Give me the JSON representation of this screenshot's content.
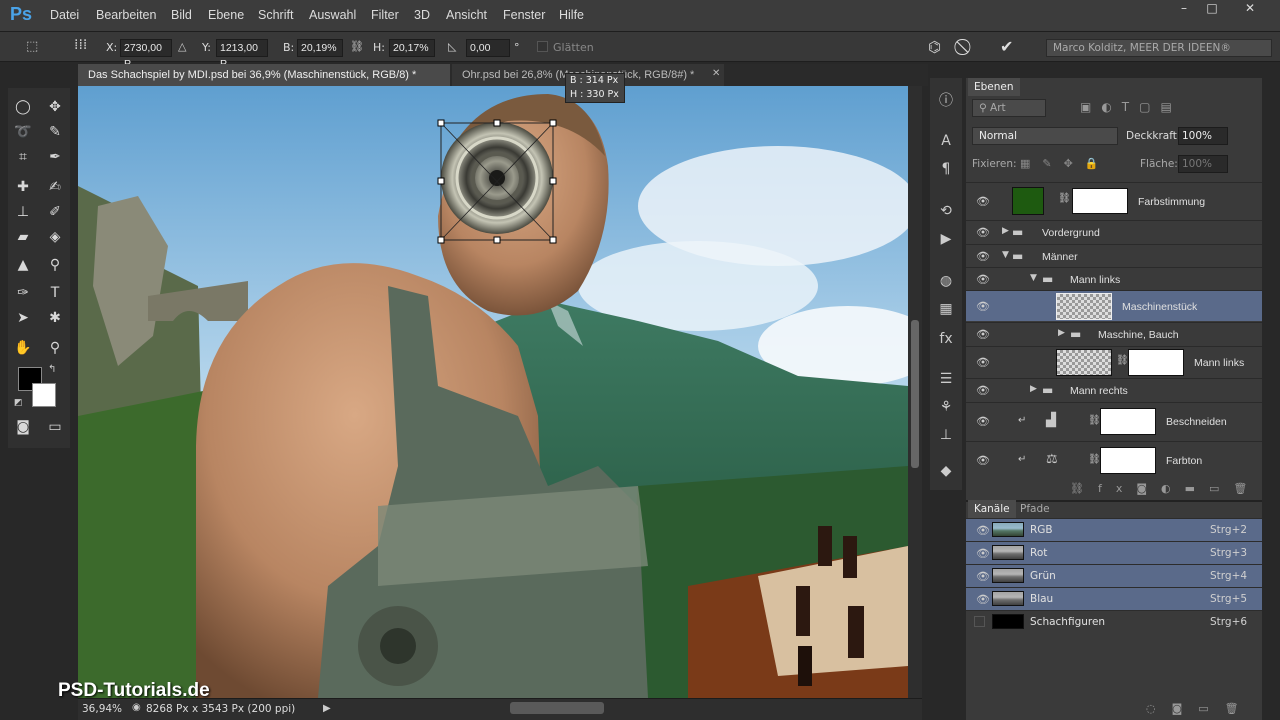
{
  "app": {
    "logo": "Ps"
  },
  "menu": [
    "Datei",
    "Bearbeiten",
    "Bild",
    "Ebene",
    "Schrift",
    "Auswahl",
    "Filter",
    "3D",
    "Ansicht",
    "Fenster",
    "Hilfe"
  ],
  "options": {
    "x_label": "X:",
    "x": "2730,00 P.",
    "y_label": "Y:",
    "y": "1213,00 P.",
    "w_label": "B:",
    "w": "20,19%",
    "h_label": "H:",
    "h": "20,17%",
    "angle": "0,00",
    "deg": "°",
    "smooth": "Glätten",
    "workspace": "Marco Kolditz, MEER DER IDEEN®"
  },
  "tabs": [
    {
      "label": "Das Schachspiel by MDI.psd bei 36,9% (Maschinenstück, RGB/8) *",
      "active": true
    },
    {
      "label": "Ohr.psd bei 26,8% (Maschinenstück, RGB/8#) *",
      "active": false
    }
  ],
  "transform_tip": {
    "w": "B : 314 Px",
    "h": "H : 330 Px"
  },
  "status": {
    "zoom": "36,94%",
    "doc": "8268 Px x 3543 Px (200 ppi)"
  },
  "watermark": "PSD-Tutorials.de",
  "layers_panel": {
    "tab": "Ebenen",
    "filter": "Art",
    "blend": "Normal",
    "opacity_label": "Deckkraft:",
    "opacity": "100%",
    "lock_label": "Fixieren:",
    "fill_label": "Fläche:",
    "fill": "100%",
    "layers": [
      {
        "name": "Farbstimmung"
      },
      {
        "name": "Vordergrund"
      },
      {
        "name": "Männer"
      },
      {
        "name": "Mann links"
      },
      {
        "name": "Maschinenstück",
        "selected": true
      },
      {
        "name": "Maschine, Bauch"
      },
      {
        "name": "Mann links"
      },
      {
        "name": "Mann rechts"
      },
      {
        "name": "Beschneiden"
      },
      {
        "name": "Farbton"
      }
    ]
  },
  "channels_panel": {
    "tabs": [
      "Kanäle",
      "Pfade"
    ],
    "channels": [
      {
        "name": "RGB",
        "key": "Strg+2"
      },
      {
        "name": "Rot",
        "key": "Strg+3"
      },
      {
        "name": "Grün",
        "key": "Strg+4"
      },
      {
        "name": "Blau",
        "key": "Strg+5"
      },
      {
        "name": "Schachfiguren",
        "key": "Strg+6"
      }
    ]
  },
  "colors": {
    "accent": "#4aa3e8",
    "selection": "#5a6a8a",
    "panel": "#3a3a3a"
  }
}
